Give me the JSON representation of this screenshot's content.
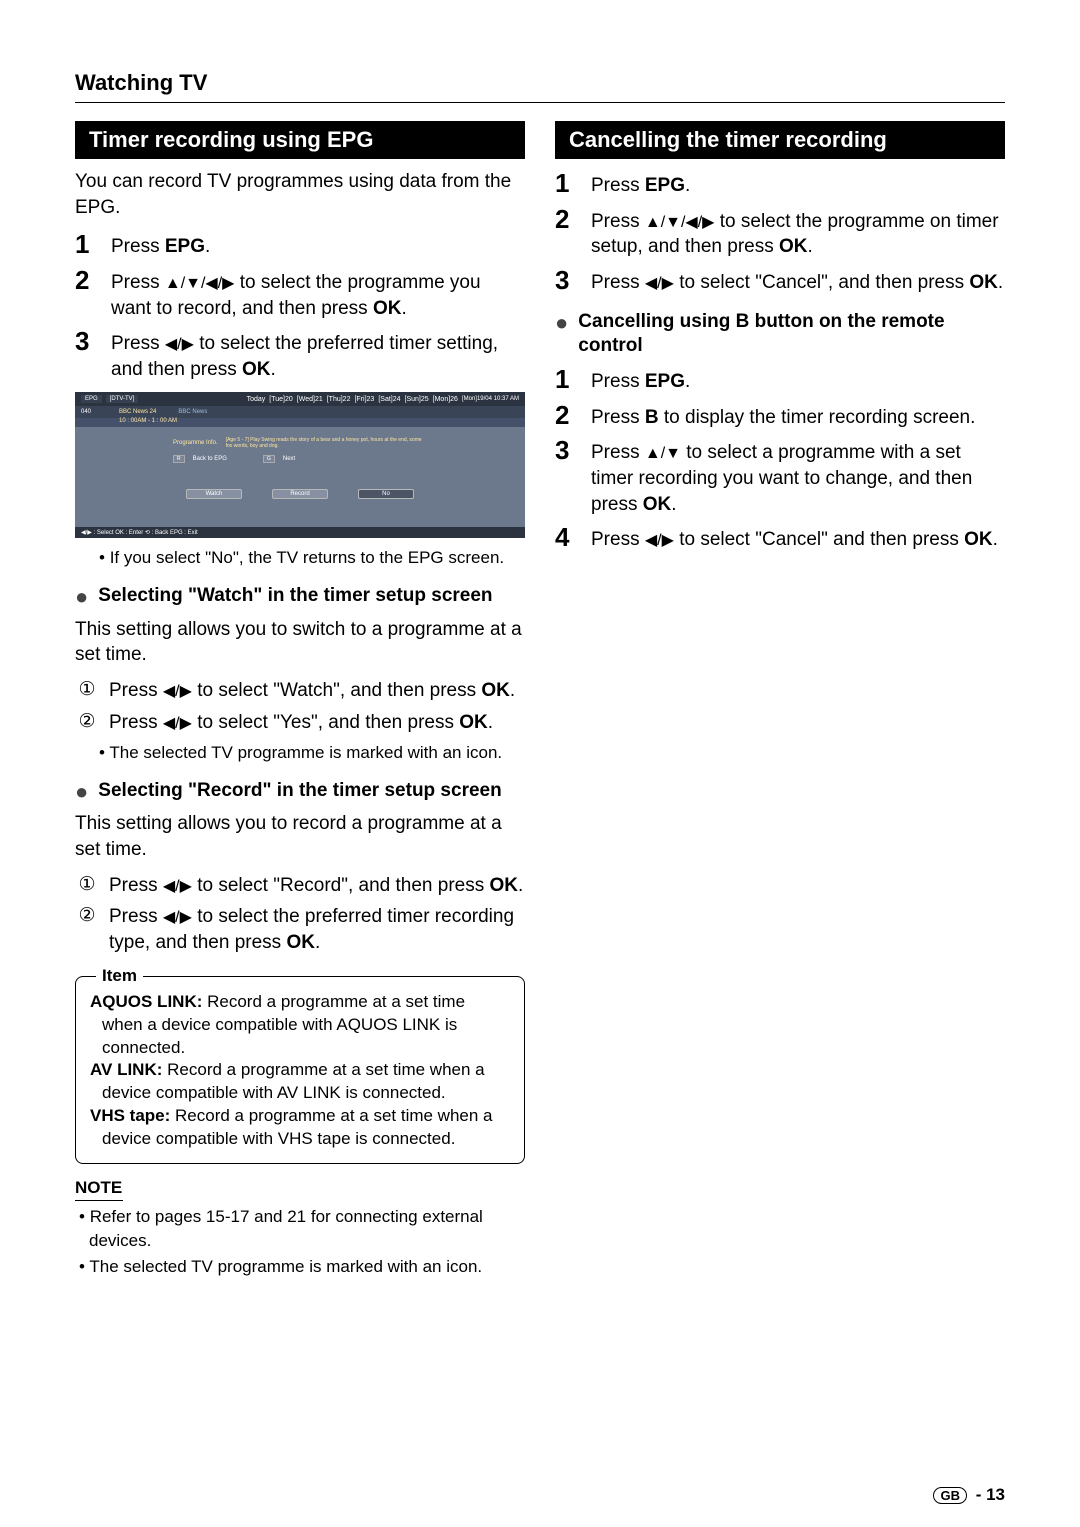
{
  "page": {
    "title": "Watching TV",
    "footer_region": "GB",
    "footer_page": "- 13"
  },
  "left": {
    "section_title": "Timer recording using EPG",
    "intro": "You can record TV programmes using data from the EPG.",
    "steps": [
      {
        "num": "1",
        "t1": "Press ",
        "b1": "EPG",
        "t2": "."
      },
      {
        "num": "2",
        "t1": "Press ",
        "arrows": "▲/▼/◀/▶",
        "t2": " to select the programme you want to record, and then press ",
        "b2": "OK",
        "t3": "."
      },
      {
        "num": "3",
        "t1": "Press ",
        "arrows": "◀/▶",
        "t2": " to select the preferred timer setting, and then press ",
        "b2": "OK",
        "t3": "."
      }
    ],
    "after_epg_note": "If you select \"No\", the TV returns to the EPG screen.",
    "watch": {
      "title": "Selecting \"Watch\" in the timer setup screen",
      "intro": "This setting allows you to switch to a programme at a set time.",
      "steps": [
        {
          "num": "①",
          "t1": "Press ",
          "arrows": "◀/▶",
          "t2": " to select \"Watch\", and then press ",
          "b2": "OK",
          "t3": "."
        },
        {
          "num": "②",
          "t1": "Press ",
          "arrows": "◀/▶",
          "t2": " to select \"Yes\", and then press ",
          "b2": "OK",
          "t3": "."
        }
      ],
      "note": "The selected TV programme is marked with an icon."
    },
    "record": {
      "title": "Selecting \"Record\" in the timer setup screen",
      "intro": "This setting allows you to record a programme at a set time.",
      "steps": [
        {
          "num": "①",
          "t1": "Press ",
          "arrows": "◀/▶",
          "t2": " to select \"Record\", and then press ",
          "b2": "OK",
          "t3": "."
        },
        {
          "num": "②",
          "t1": "Press ",
          "arrows": "◀/▶",
          "t2": " to select the preferred timer recording type, and then press ",
          "b2": "OK",
          "t3": "."
        }
      ]
    },
    "item_box": {
      "label": "Item",
      "rows": [
        {
          "b": "AQUOS LINK:",
          "t": " Record a programme at a set time when a device compatible with AQUOS LINK is connected."
        },
        {
          "b": "AV LINK:",
          "t": " Record a programme at a set time when a device compatible with AV LINK is connected."
        },
        {
          "b": "VHS tape:",
          "t": " Record a programme at a set time when a device compatible with VHS tape is connected."
        }
      ]
    },
    "note_label": "NOTE",
    "notes": [
      "Refer to pages 15-17 and 21 for connecting external devices.",
      "The selected TV programme is marked with an icon."
    ]
  },
  "right": {
    "section_title": "Cancelling the timer recording",
    "steps": [
      {
        "num": "1",
        "t1": "Press ",
        "b1": "EPG",
        "t2": "."
      },
      {
        "num": "2",
        "t1": "Press ",
        "arrows": "▲/▼/◀/▶",
        "t2": " to select the programme on timer setup, and then press ",
        "b2": "OK",
        "t3": "."
      },
      {
        "num": "3",
        "t1": "Press ",
        "arrows": "◀/▶",
        "t2": " to select \"Cancel\", and then press ",
        "b2": "OK",
        "t3": "."
      }
    ],
    "subhead": "Cancelling using B button on the remote control",
    "sub_steps": [
      {
        "num": "1",
        "t1": "Press ",
        "b1": "EPG",
        "t2": "."
      },
      {
        "num": "2",
        "t1": "Press ",
        "b1": "B",
        "t2": " to display the timer recording screen."
      },
      {
        "num": "3",
        "t1": "Press ",
        "arrows": "▲/▼",
        "t2": " to select a programme with a set timer recording you want to change, and then press ",
        "b2": "OK",
        "t3": "."
      },
      {
        "num": "4",
        "t1": "Press ",
        "arrows": "◀/▶",
        "t2": " to select \"Cancel\" and then press ",
        "b2": "OK",
        "t3": "."
      }
    ]
  },
  "epg": {
    "tag1": "EPG",
    "tag2": "[DTV-TV]",
    "days": [
      "Today",
      "[Tue]20",
      "[Wed]21",
      "[Thu]22",
      "[Fri]23",
      "[Sat]24",
      "[Sun]25",
      "[Mon]26"
    ],
    "date_time": "[Mon]19/04 10:37 AM",
    "ch_num": "040",
    "ch_name": "BBC News 24",
    "time_range": "10 : 00AM - 1 : 00 AM",
    "prog_title": "BBC News",
    "info_label": "Programme Info.",
    "info_text": "[Age 5 - 7] Play Swing reads the story of a bear and a honey pot, hours at the end, some fox words, boy and dog.",
    "back_badge": "R",
    "back_label": "Back to EPG",
    "next_badge": "G",
    "next_label": "Next",
    "btn_watch": "Watch",
    "btn_record": "Record",
    "btn_no": "No",
    "foot": "◀/▶ : Select   OK  : Enter   ⟲  : Back   EPG  : Exit"
  }
}
